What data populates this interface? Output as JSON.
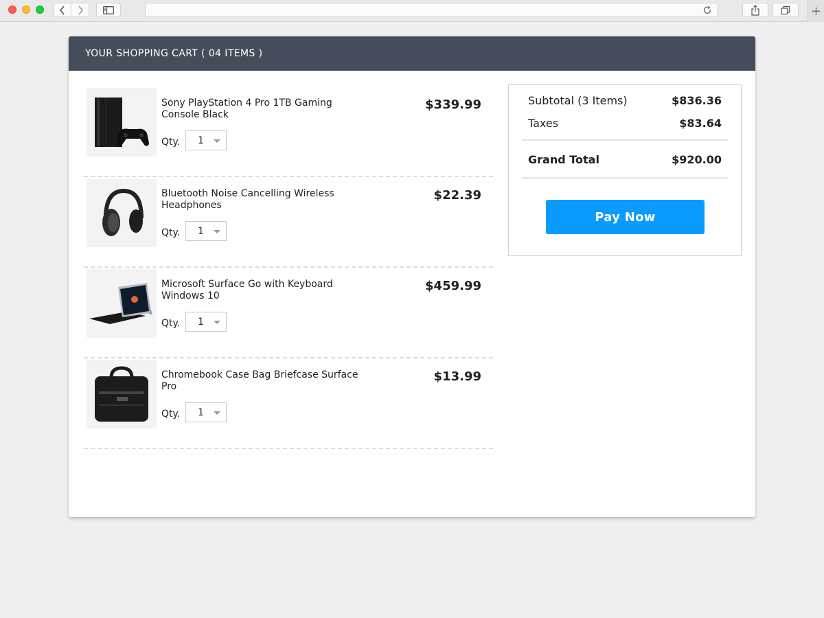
{
  "cart": {
    "header": "YOUR SHOPPING CART ( 04 ITEMS )",
    "qty_label": "Qty.",
    "items": [
      {
        "name": "Sony PlayStation 4 Pro 1TB Gaming Console Black",
        "price": "$339.99",
        "qty": "1",
        "icon": "game-console-icon"
      },
      {
        "name": "Bluetooth Noise Cancelling Wireless Headphones",
        "price": "$22.39",
        "qty": "1",
        "icon": "headphones-icon"
      },
      {
        "name": "Microsoft Surface Go with Keyboard Windows 10",
        "price": "$459.99",
        "qty": "1",
        "icon": "tablet-icon"
      },
      {
        "name": "Chromebook Case Bag Briefcase Surface Pro",
        "price": "$13.99",
        "qty": "1",
        "icon": "briefcase-icon"
      }
    ]
  },
  "summary": {
    "subtotal_label": "Subtotal (3 Items)",
    "subtotal_value": "$836.36",
    "taxes_label": "Taxes",
    "taxes_value": "$83.64",
    "grand_label": "Grand Total",
    "grand_value": "$920.00",
    "pay_label": "Pay Now"
  },
  "colors": {
    "header_bg": "#464d5a",
    "pay_button": "#0b9bff",
    "page_bg": "#efefef"
  }
}
